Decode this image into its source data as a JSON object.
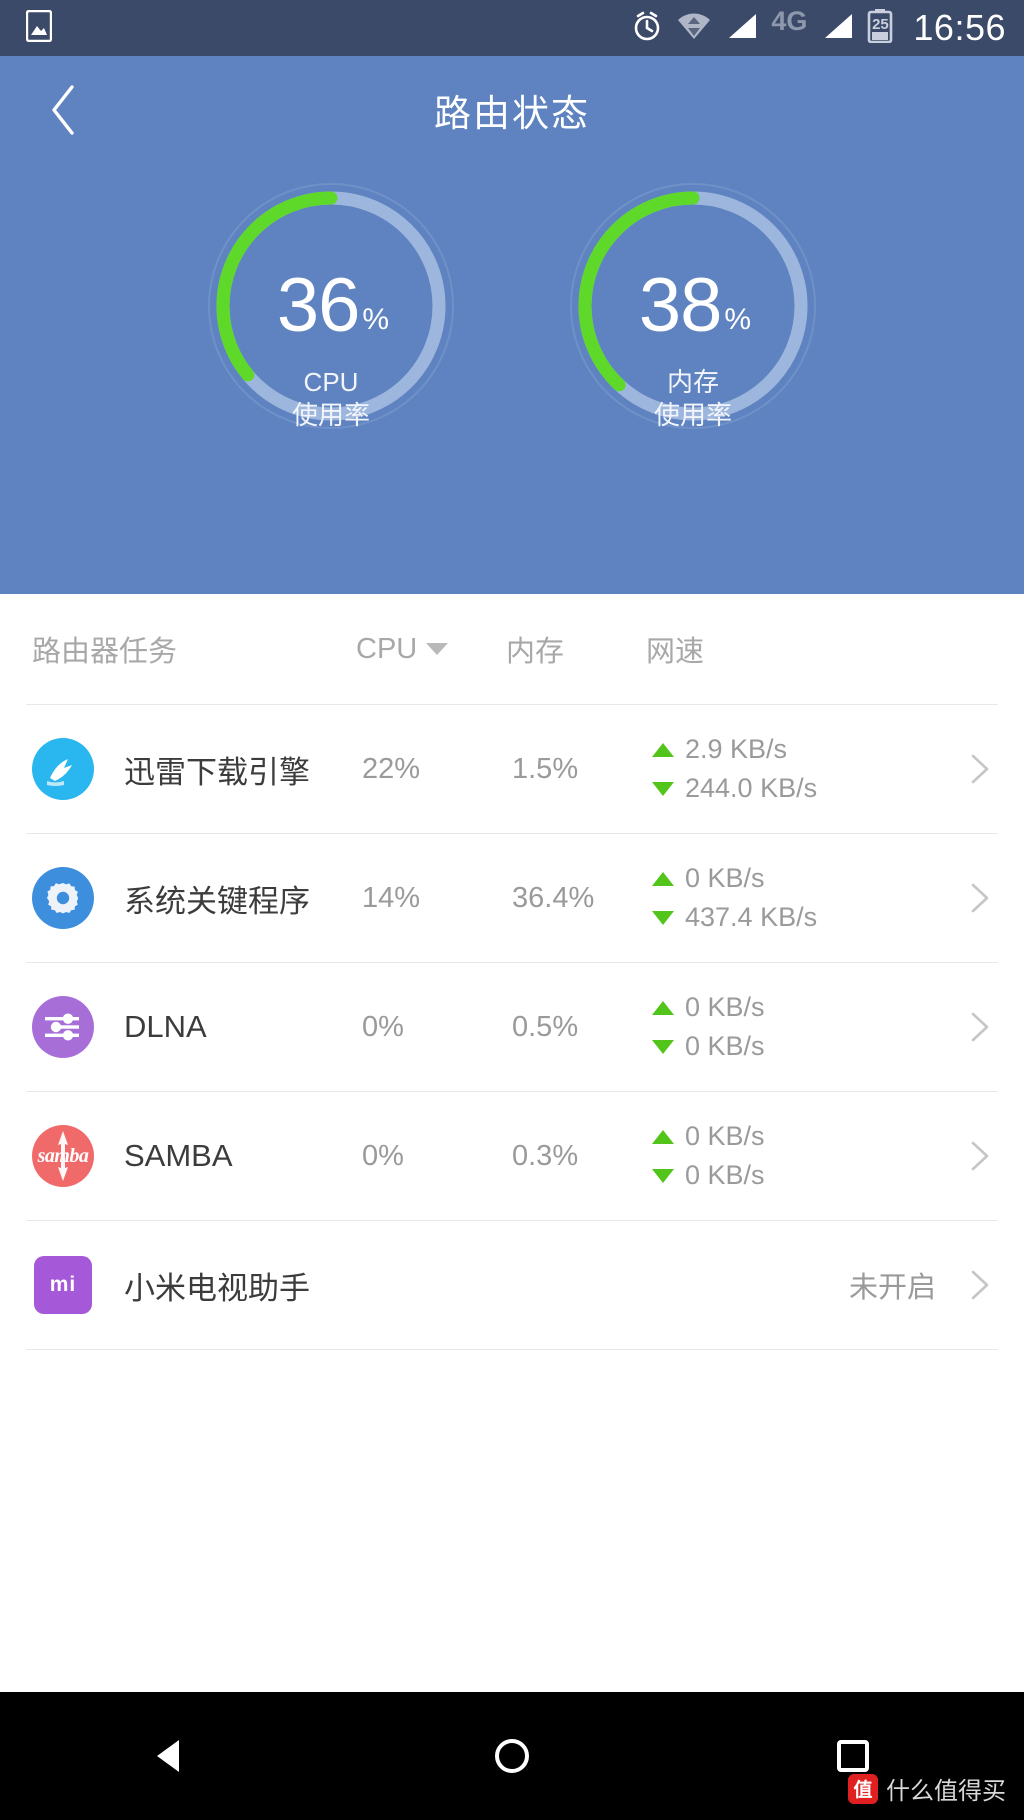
{
  "status_bar": {
    "time": "16:56",
    "battery_level": "25",
    "network_type": "4G",
    "icons": [
      "image-icon",
      "alarm-icon",
      "wifi-icon",
      "signal-icon",
      "network-type-label",
      "signal-icon-2",
      "battery-icon"
    ]
  },
  "header": {
    "back_icon": "back-chevron-icon",
    "title": "路由状态",
    "gauges": [
      {
        "value": "36",
        "unit": "%",
        "percent": 36,
        "label_line1": "CPU",
        "label_line2": "使用率",
        "arc_color": "#5ed92a",
        "track_color": "#a6bee0"
      },
      {
        "value": "38",
        "unit": "%",
        "percent": 38,
        "label_line1": "内存",
        "label_line2": "使用率",
        "arc_color": "#5ed92a",
        "track_color": "#a6bee0"
      }
    ]
  },
  "table": {
    "columns": {
      "name": "路由器任务",
      "cpu": "CPU",
      "memory": "内存",
      "network": "网速"
    },
    "sort_indicator": "caret-down-icon",
    "rows": [
      {
        "icon": "xunlei-icon",
        "name": "迅雷下载引擎",
        "cpu": "22%",
        "memory": "1.5%",
        "upload": "2.9 KB/s",
        "download": "244.0 KB/s",
        "status": "",
        "chevron": "chevron-right-icon"
      },
      {
        "icon": "system-gear-icon",
        "name": "系统关键程序",
        "cpu": "14%",
        "memory": "36.4%",
        "upload": "0 KB/s",
        "download": "437.4 KB/s",
        "status": "",
        "chevron": "chevron-right-icon"
      },
      {
        "icon": "dlna-icon",
        "name": "DLNA",
        "cpu": "0%",
        "memory": "0.5%",
        "upload": "0 KB/s",
        "download": "0 KB/s",
        "status": "",
        "chevron": "chevron-right-icon"
      },
      {
        "icon": "samba-icon",
        "name": "SAMBA",
        "cpu": "0%",
        "memory": "0.3%",
        "upload": "0 KB/s",
        "download": "0 KB/s",
        "status": "",
        "chevron": "chevron-right-icon"
      },
      {
        "icon": "mi-tv-assistant-icon",
        "name": "小米电视助手",
        "cpu": "",
        "memory": "",
        "upload": "",
        "download": "",
        "status": "未开启",
        "chevron": "chevron-right-icon"
      }
    ]
  },
  "nav_bottom": {
    "back": "triangle-back-icon",
    "home": "circle-home-icon",
    "recents": "square-recents-icon"
  },
  "watermark": {
    "badge": "值",
    "text": "什么值得买"
  },
  "colors": {
    "status_bar_bg": "#3c4a69",
    "header_bg": "#5e83c0",
    "accent_green": "#5ed92a",
    "text_gray": "#9a9a9a"
  }
}
